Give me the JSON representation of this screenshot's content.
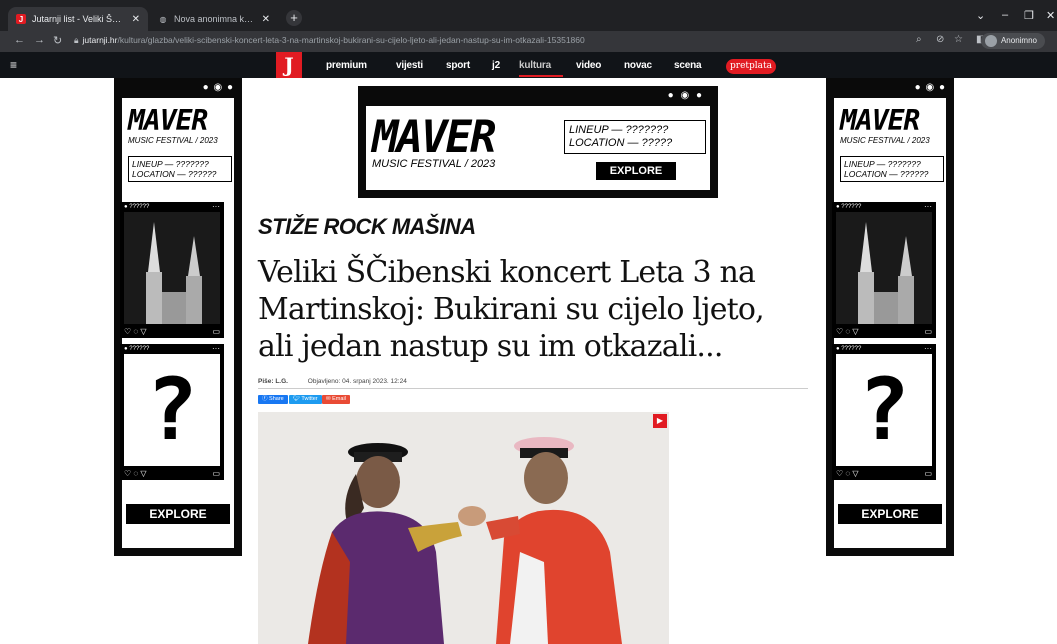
{
  "browser": {
    "tabs": [
      {
        "title": "Jutarnji list - Veliki ŠČibenski ko",
        "active": true,
        "favicon": "J"
      },
      {
        "title": "Nova anonimna kartica",
        "active": false,
        "favicon": "incognito-icon"
      }
    ],
    "url_host": "jutarnji.hr",
    "url_path": "/kultura/glazba/veliki-scibenski-koncert-leta-3-na-martinskoj-bukirani-su-cijelo-ljeto-ali-jedan-nastup-su-im-otkazali-15351860",
    "profile_label": "Anonimno"
  },
  "site": {
    "logo": "J",
    "nav": [
      "premium",
      "vijesti",
      "sport",
      "j2",
      "kultura",
      "video",
      "novac",
      "scena"
    ],
    "current_nav": "kultura",
    "subscribe_label": "pretplata",
    "brand_color": "#e11b22"
  },
  "ad": {
    "brand": "MAVER",
    "festival": "MUSIC FESTIVAL / 2023",
    "lineup": "LINEUP — ???????",
    "location": "LOCATION — ??????",
    "location_short": "LOCATION — ?????",
    "post_user": "??????",
    "explore": "EXPLORE",
    "question_mark": "?"
  },
  "article": {
    "kicker": "STIŽE ROCK MAŠINA",
    "headline": "Veliki ŠČibenski koncert Leta 3 na Martinskoj: Bukirani su cijelo ljeto, ali jedan nastup su im otkazali...",
    "author": "Piše: L.G.",
    "published": "Objavljeno: 04. srpanj 2023. 12:24",
    "share_buttons": [
      {
        "label": "Share",
        "color": "#1877f2"
      },
      {
        "label": "Twitter",
        "color": "#1d9bf0"
      },
      {
        "label": "Email",
        "color": "#e94b35"
      }
    ]
  }
}
